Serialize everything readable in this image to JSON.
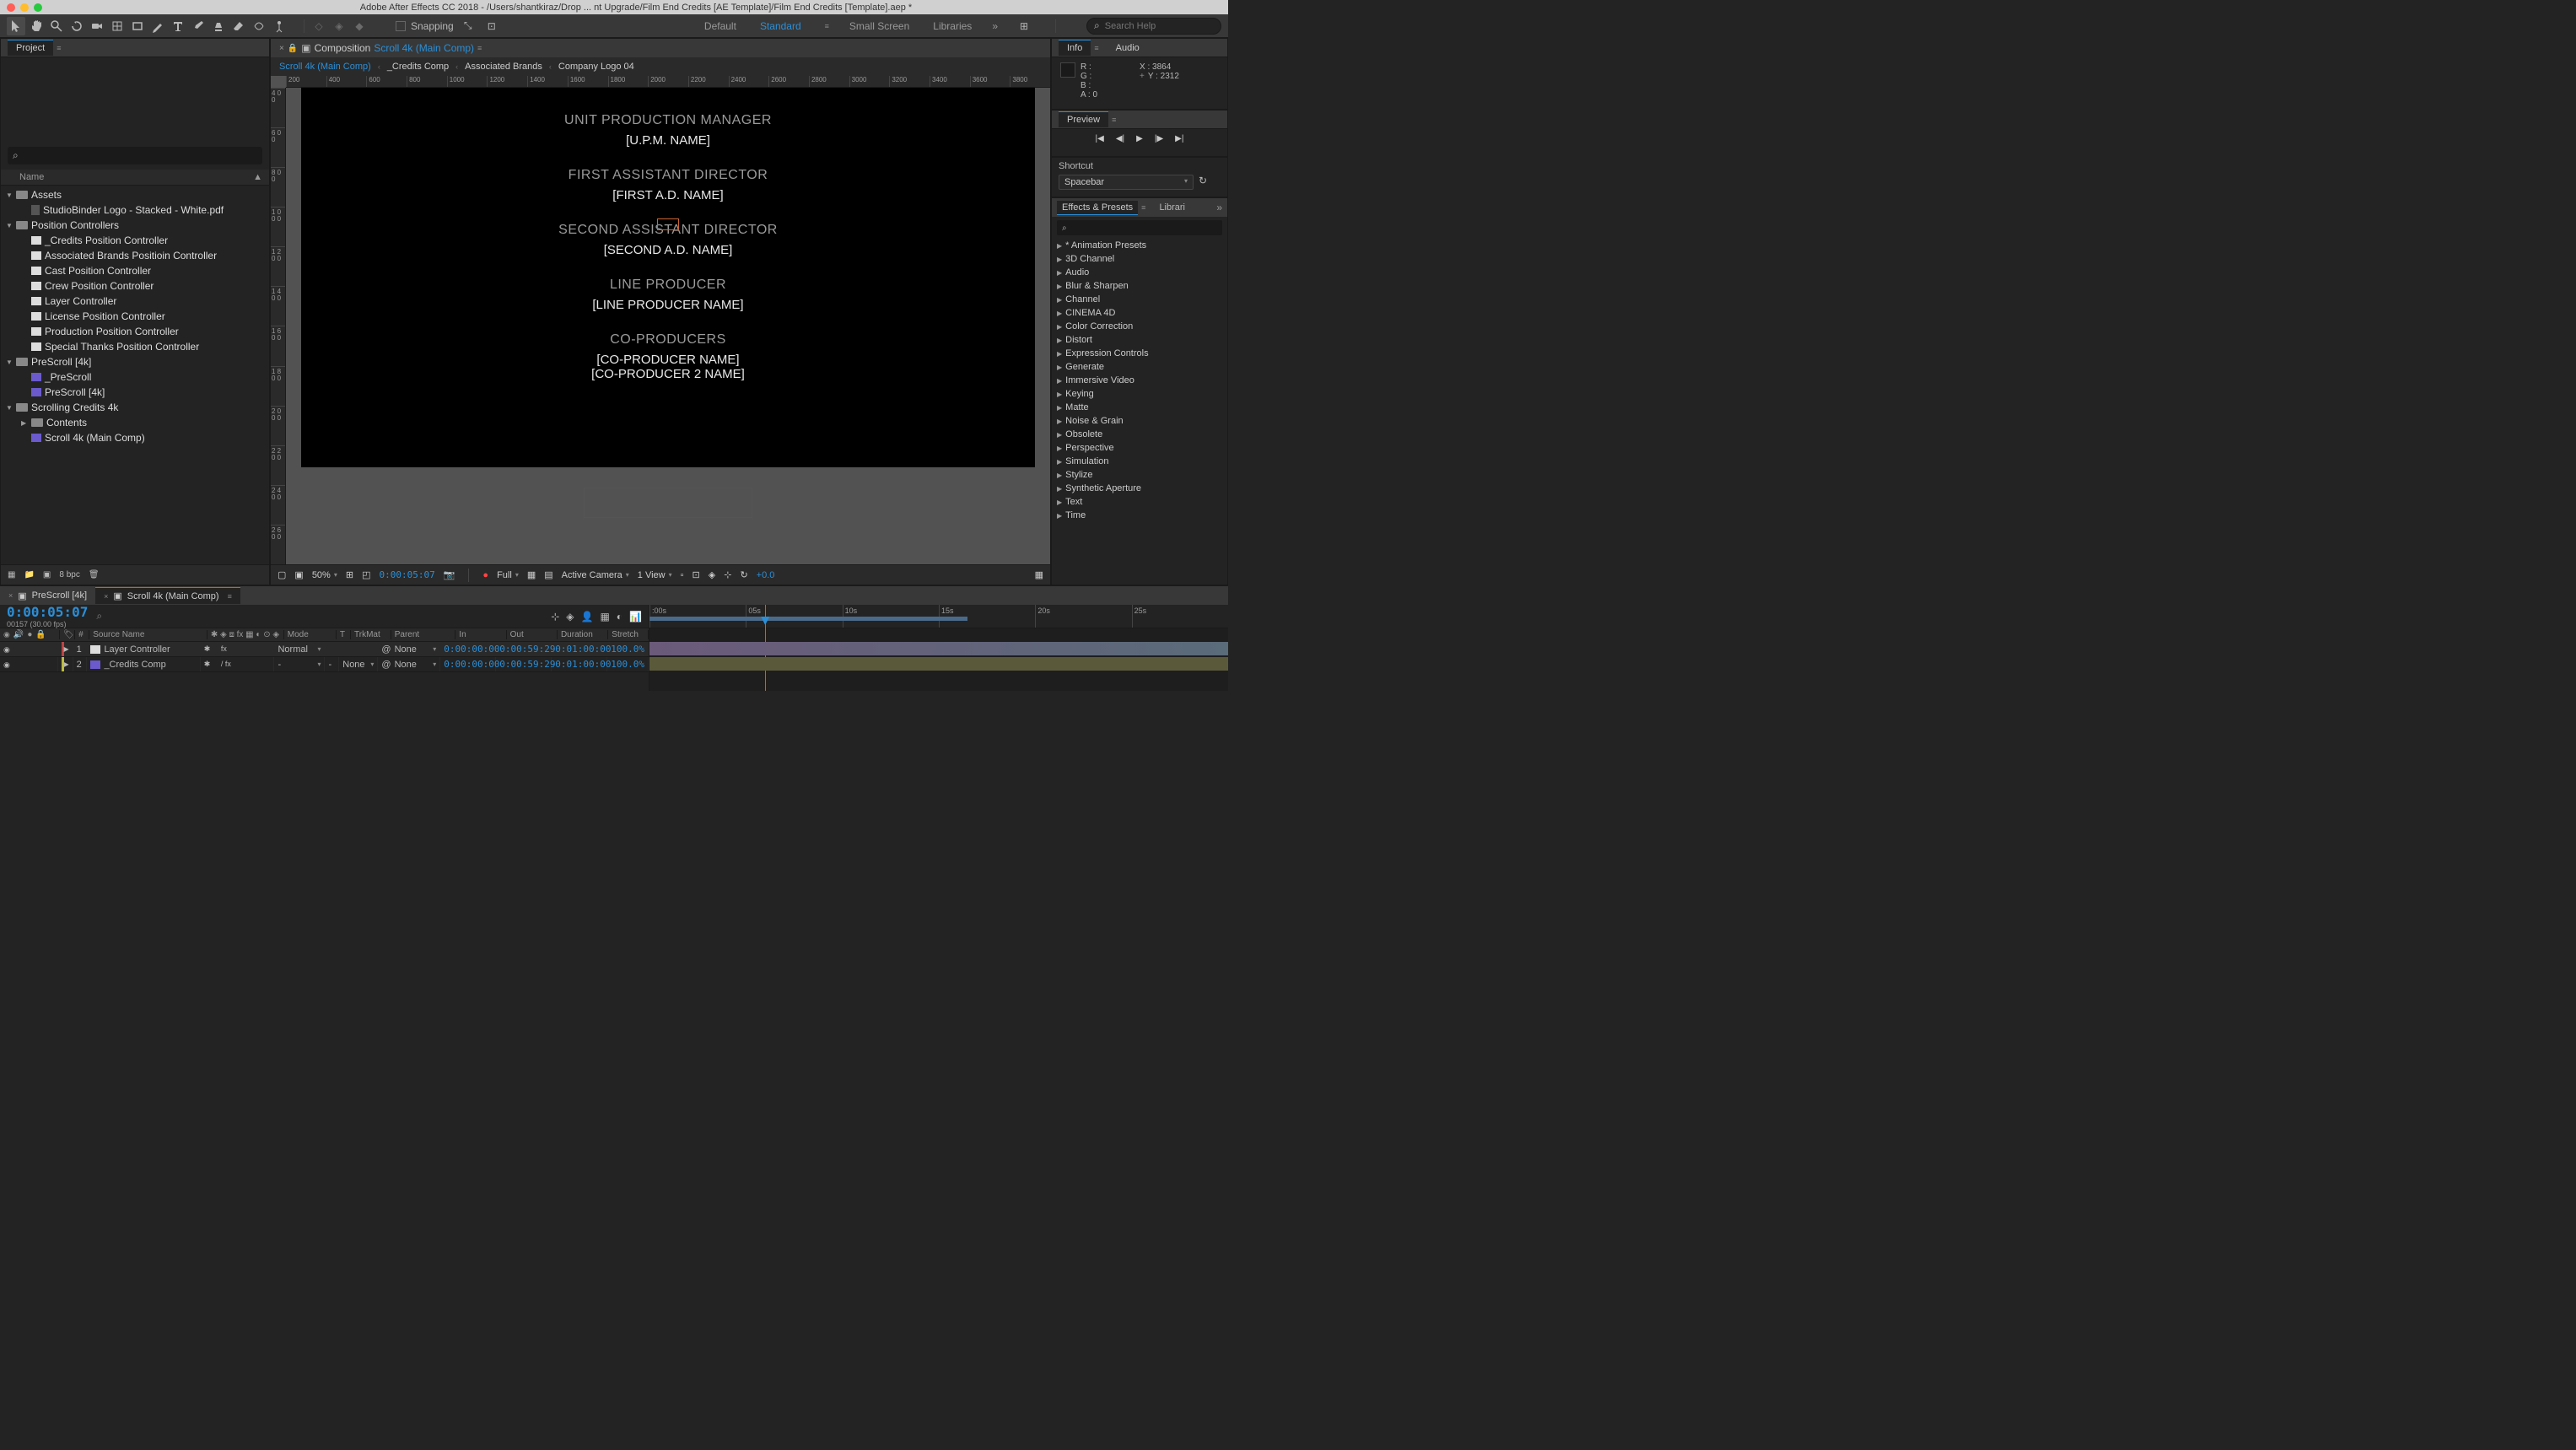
{
  "titlebar": "Adobe After Effects CC 2018 - /Users/shantkiraz/Drop ... nt Upgrade/Film End Credits [AE Template]/Film End Credits [Template].aep *",
  "toolbar": {
    "snapping": "Snapping",
    "workspaces": {
      "default": "Default",
      "standard": "Standard",
      "small": "Small Screen",
      "libraries": "Libraries"
    },
    "search_placeholder": "Search Help"
  },
  "project": {
    "tab": "Project",
    "name_header": "Name",
    "items": [
      {
        "label": "Assets",
        "type": "folder",
        "level": 0,
        "expanded": true
      },
      {
        "label": "StudioBinder Logo - Stacked - White.pdf",
        "type": "file",
        "level": 1
      },
      {
        "label": "Position Controllers",
        "type": "folder",
        "level": 0,
        "expanded": true
      },
      {
        "label": "_Credits Position Controller",
        "type": "solid",
        "level": 1
      },
      {
        "label": "Associated Brands Positioin Controller",
        "type": "solid",
        "level": 1
      },
      {
        "label": "Cast Position Controller",
        "type": "solid",
        "level": 1
      },
      {
        "label": "Crew Position Controller",
        "type": "solid",
        "level": 1
      },
      {
        "label": "Layer Controller",
        "type": "solid",
        "level": 1
      },
      {
        "label": "License Position Controller",
        "type": "solid",
        "level": 1
      },
      {
        "label": "Production Position Controller",
        "type": "solid",
        "level": 1
      },
      {
        "label": "Special Thanks Position Controller",
        "type": "solid",
        "level": 1
      },
      {
        "label": "PreScroll [4k]",
        "type": "folder",
        "level": 0,
        "expanded": true
      },
      {
        "label": "_PreScroll",
        "type": "comp",
        "level": 1
      },
      {
        "label": "PreScroll [4k]",
        "type": "comp",
        "level": 1
      },
      {
        "label": "Scrolling Credits 4k",
        "type": "folder",
        "level": 0,
        "expanded": true
      },
      {
        "label": "Contents",
        "type": "folder",
        "level": 1
      },
      {
        "label": "Scroll 4k (Main Comp)",
        "type": "comp",
        "level": 1
      }
    ],
    "bpc": "8 bpc"
  },
  "comp": {
    "tab_label": "Composition",
    "tab_name": "Scroll 4k (Main Comp)",
    "breadcrumb": [
      {
        "label": "Scroll 4k (Main Comp)",
        "active": true
      },
      {
        "label": "_Credits Comp",
        "active": false
      },
      {
        "label": "Associated Brands",
        "active": false
      },
      {
        "label": "Company Logo 04",
        "active": false
      }
    ],
    "ruler_h": [
      "200",
      "400",
      "600",
      "800",
      "1000",
      "1200",
      "1400",
      "1600",
      "1800",
      "2000",
      "2200",
      "2400",
      "2600",
      "2800",
      "3000",
      "3200",
      "3400",
      "3600",
      "3800"
    ],
    "ruler_v": [
      "400",
      "600",
      "800",
      "1000",
      "1200",
      "1400",
      "1600",
      "1800",
      "2000",
      "2200",
      "2400",
      "2600"
    ],
    "credits": [
      {
        "title": "UNIT PRODUCTION MANAGER",
        "names": [
          "[U.P.M. NAME]"
        ]
      },
      {
        "title": "FIRST ASSISTANT DIRECTOR",
        "names": [
          "[FIRST A.D. NAME]"
        ]
      },
      {
        "title": "SECOND ASSISTANT DIRECTOR",
        "names": [
          "[SECOND A.D. NAME]"
        ]
      },
      {
        "title": "LINE PRODUCER",
        "names": [
          "[LINE PRODUCER NAME]"
        ]
      },
      {
        "title": "CO-PRODUCERS",
        "names": [
          "[CO-PRODUCER NAME]",
          "[CO-PRODUCER 2 NAME]"
        ]
      }
    ],
    "footer": {
      "zoom": "50%",
      "timecode": "0:00:05:07",
      "resolution": "Full",
      "camera": "Active Camera",
      "views": "1 View",
      "exposure": "+0.0"
    }
  },
  "info": {
    "tab": "Info",
    "audio_tab": "Audio",
    "r": "R :",
    "g": "G :",
    "b": "B :",
    "a": "A :  0",
    "x": "X :  3864",
    "y": "Y :  2312"
  },
  "preview": {
    "tab": "Preview",
    "shortcut_label": "Shortcut",
    "shortcut_value": "Spacebar"
  },
  "effects": {
    "tab": "Effects & Presets",
    "lib_tab": "Librari",
    "items": [
      "* Animation Presets",
      "3D Channel",
      "Audio",
      "Blur & Sharpen",
      "Channel",
      "CINEMA 4D",
      "Color Correction",
      "Distort",
      "Expression Controls",
      "Generate",
      "Immersive Video",
      "Keying",
      "Matte",
      "Noise & Grain",
      "Obsolete",
      "Perspective",
      "Simulation",
      "Stylize",
      "Synthetic Aperture",
      "Text",
      "Time"
    ]
  },
  "timeline": {
    "tabs": [
      {
        "label": "PreScroll [4k]",
        "active": false
      },
      {
        "label": "Scroll 4k (Main Comp)",
        "active": true
      }
    ],
    "timecode": "0:00:05:07",
    "fps": "00157 (30.00 fps)",
    "headers": {
      "num": "#",
      "source": "Source Name",
      "mode": "Mode",
      "t": "T",
      "trkmat": "TrkMat",
      "parent": "Parent",
      "in": "In",
      "out": "Out",
      "duration": "Duration",
      "stretch": "Stretch"
    },
    "layers": [
      {
        "num": "1",
        "name": "Layer Controller",
        "color": "#b44",
        "mode": "Normal",
        "trkmat": "",
        "parent": "None",
        "in": "0:00:00:00",
        "out": "0:00:59:29",
        "dur": "0:01:00:00",
        "stretch": "100.0%",
        "icon": "solid"
      },
      {
        "num": "2",
        "name": "_Credits Comp",
        "color": "#bb4",
        "mode": "-",
        "trkmat": "None",
        "parent": "None",
        "in": "0:00:00:00",
        "out": "0:00:59:29",
        "dur": "0:01:00:00",
        "stretch": "100.0%",
        "icon": "comp"
      }
    ],
    "ruler": [
      ":00s",
      "05s",
      "10s",
      "15s",
      "20s",
      "25s"
    ]
  }
}
